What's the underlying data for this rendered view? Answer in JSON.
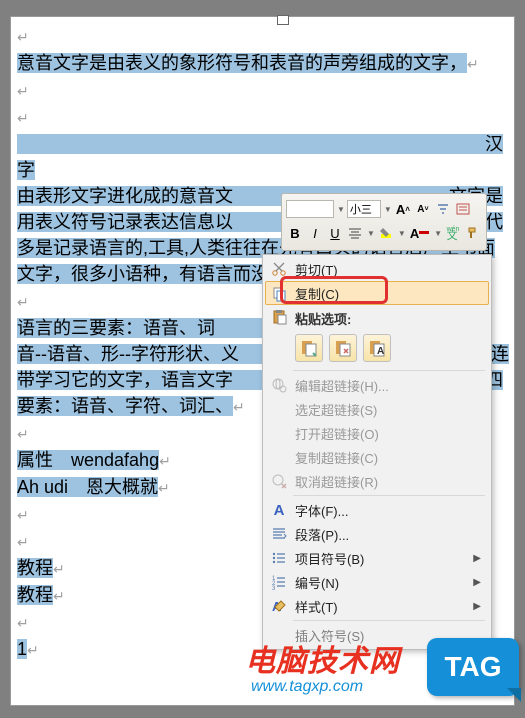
{
  "document": {
    "lines": [
      "意音文字是由表义的象形符号和表音的声旁组成的文字，",
      "",
      "",
      "　　　　　　　　　　　　　　　　　　　　　　　　　　汉字",
      "由表形文字进化成的意音文　　　　　　　　　　　、文字是",
      "用表义符号记录表达信息以　　　　　　　　　　　具。现代",
      "多是记录语言的,工具,人类往往在先有口头的语言后产生书面",
      "文字，很多小语种，有语言而没有文字。",
      "",
      "语言的三要素：语音、词　　　　　　　　　的三要素是：",
      "音--语音、形--字符形状、义　　　　　　　　们语言，往往连",
      "带学习它的文字，语言文字　　　　　　　　合并同类型为四",
      "要素：语音、字符、词汇、",
      "",
      "属性　wendafahg",
      "Ah udi　恩大概就",
      "",
      "",
      "教程",
      "教程",
      "",
      "1"
    ]
  },
  "mini_toolbar": {
    "font_size_label": "小三",
    "grow": "A",
    "shrink": "A"
  },
  "context_menu": {
    "cut": "剪切(T)",
    "copy": "复制(C)",
    "paste_header": "粘贴选项:",
    "edit_hyperlink": "编辑超链接(H)...",
    "select_hyperlink": "选定超链接(S)",
    "open_hyperlink": "打开超链接(O)",
    "copy_hyperlink": "复制超链接(C)",
    "remove_hyperlink": "取消超链接(R)",
    "font": "字体(F)...",
    "paragraph": "段落(P)...",
    "bullets": "项目符号(B)",
    "numbering": "编号(N)",
    "styles": "样式(T)",
    "insert_symbol": "插入符号(S)"
  },
  "watermark": {
    "brand_cn": "电脑技术网",
    "url": "www.tagxp.com",
    "tag": "TAG"
  }
}
